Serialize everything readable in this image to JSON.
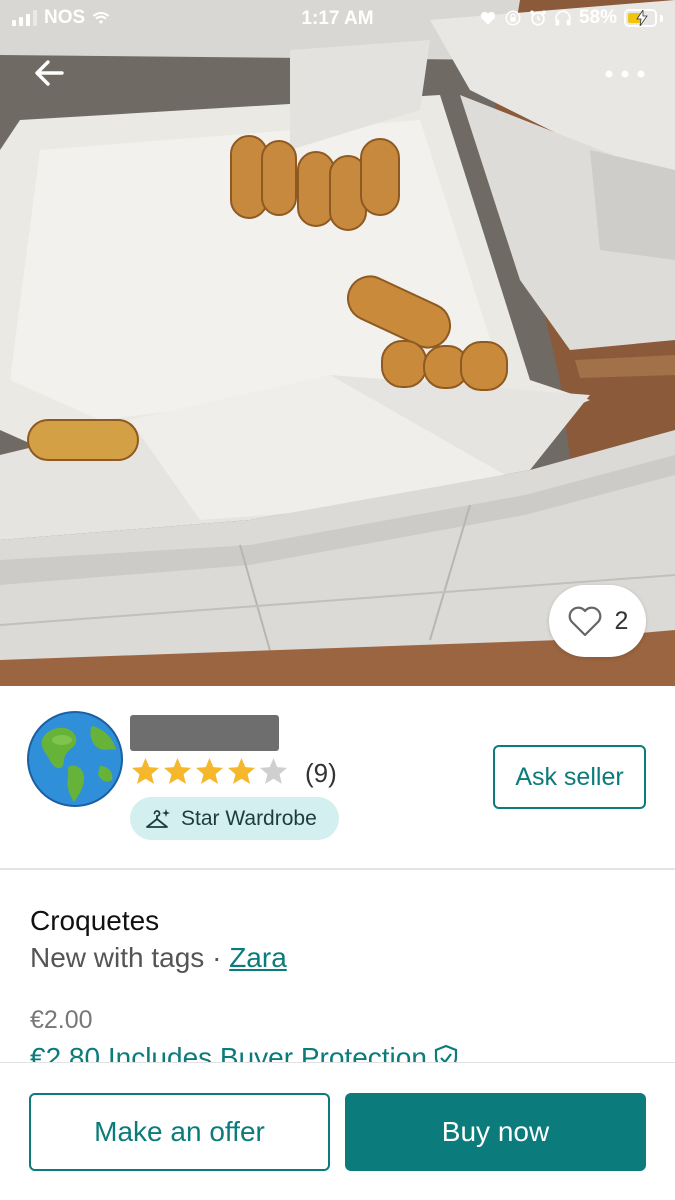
{
  "status_bar": {
    "carrier": "NOS",
    "time": "1:17 AM",
    "battery_percent": "58%",
    "battery_level": 0.58,
    "icons": [
      "signal-icon",
      "wifi-icon",
      "heart-icon",
      "screen-lock-icon",
      "alarm-icon",
      "headphones-icon",
      "battery-charging-icon"
    ]
  },
  "photo": {
    "favorites_count": "2",
    "icons": [
      "back-arrow-icon",
      "more-icon",
      "heart-outline-icon"
    ]
  },
  "seller": {
    "rating": 4,
    "rating_max": 5,
    "review_count": "(9)",
    "badge_label": "Star Wardrobe",
    "ask_button": "Ask seller",
    "avatar_icon": "globe-icon"
  },
  "item": {
    "title": "Croquetes",
    "condition": "New with tags",
    "separator": " · ",
    "brand": "Zara",
    "price": "€2.00",
    "price_with_protection": "€2.80 Includes Buyer Protection"
  },
  "actions": {
    "offer_label": "Make an offer",
    "buy_label": "Buy now"
  },
  "colors": {
    "accent": "#0b7b7b",
    "badge_bg": "#d3efef",
    "star": "#f5b72b"
  }
}
